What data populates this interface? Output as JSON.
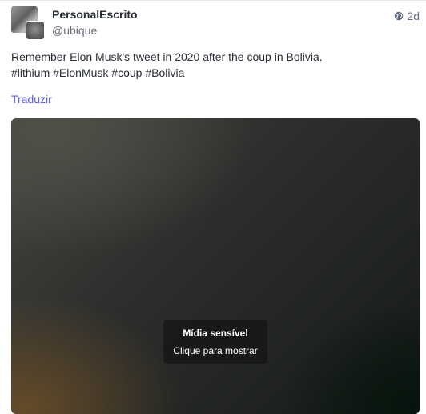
{
  "account": {
    "display_name": "PersonalEscrito",
    "handle": "@ubique"
  },
  "status": {
    "visibility_icon": "globe-icon",
    "relative_time": "2d",
    "text_line1": "Remember Elon Musk's tweet in 2020 after the coup in Bolivia.",
    "hashtags": [
      "#lithium",
      "#ElonMusk",
      "#coup",
      "#Bolivia"
    ],
    "translate_label": "Traduzir"
  },
  "media": {
    "sensitive_title": "Mídia sensível",
    "sensitive_action": "Clique para mostrar"
  },
  "colors": {
    "link": "#595aff",
    "text": "#282c37",
    "muted": "#606984"
  }
}
